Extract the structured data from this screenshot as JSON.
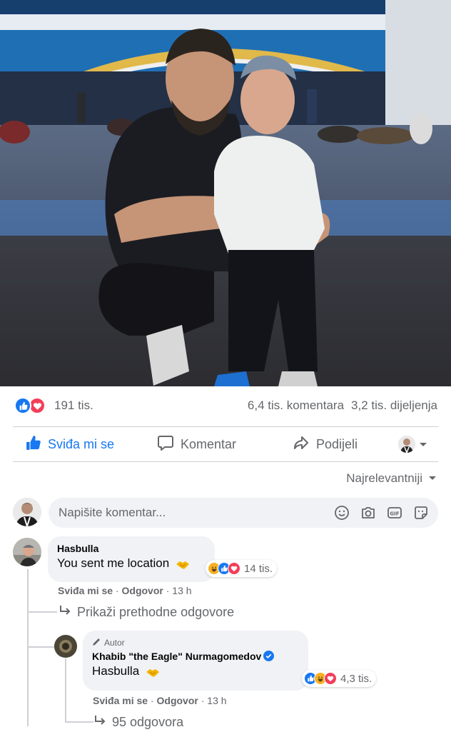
{
  "post": {
    "reactions_count": "191 tis.",
    "comments_count": "6,4 tis. komentara",
    "shares_count": "3,2 tis. dijeljenja",
    "reaction_icons": [
      "like-icon",
      "love-icon"
    ]
  },
  "actions": {
    "like_label": "Sviđa mi se",
    "comment_label": "Komentar",
    "share_label": "Podijeli"
  },
  "sort": {
    "label": "Najrelevantniji"
  },
  "composer": {
    "placeholder": "Napišite komentar...",
    "icons": [
      "emoji-icon",
      "camera-icon",
      "gif-icon",
      "sticker-icon"
    ]
  },
  "comments": [
    {
      "author": "Hasbulla",
      "text": "You sent me location",
      "reactions": "14 tis.",
      "like_label": "Sviđa mi se",
      "reply_label": "Odgovor",
      "time": "13 h",
      "show_previous": "Prikaži prethodne odgovore"
    },
    {
      "badge": "Autor",
      "author": "Khabib \"the Eagle\" Nurmagomedov",
      "text": "Hasbulla",
      "reactions": "4,3 tis.",
      "like_label": "Sviđa mi se",
      "reply_label": "Odgovor",
      "time": "13 h",
      "replies": "95 odgovora"
    }
  ],
  "colors": {
    "accent": "#1877f2",
    "love": "#f33e58",
    "haha": "#f7b125",
    "muted": "#65676b",
    "bubble": "#f0f2f5"
  }
}
